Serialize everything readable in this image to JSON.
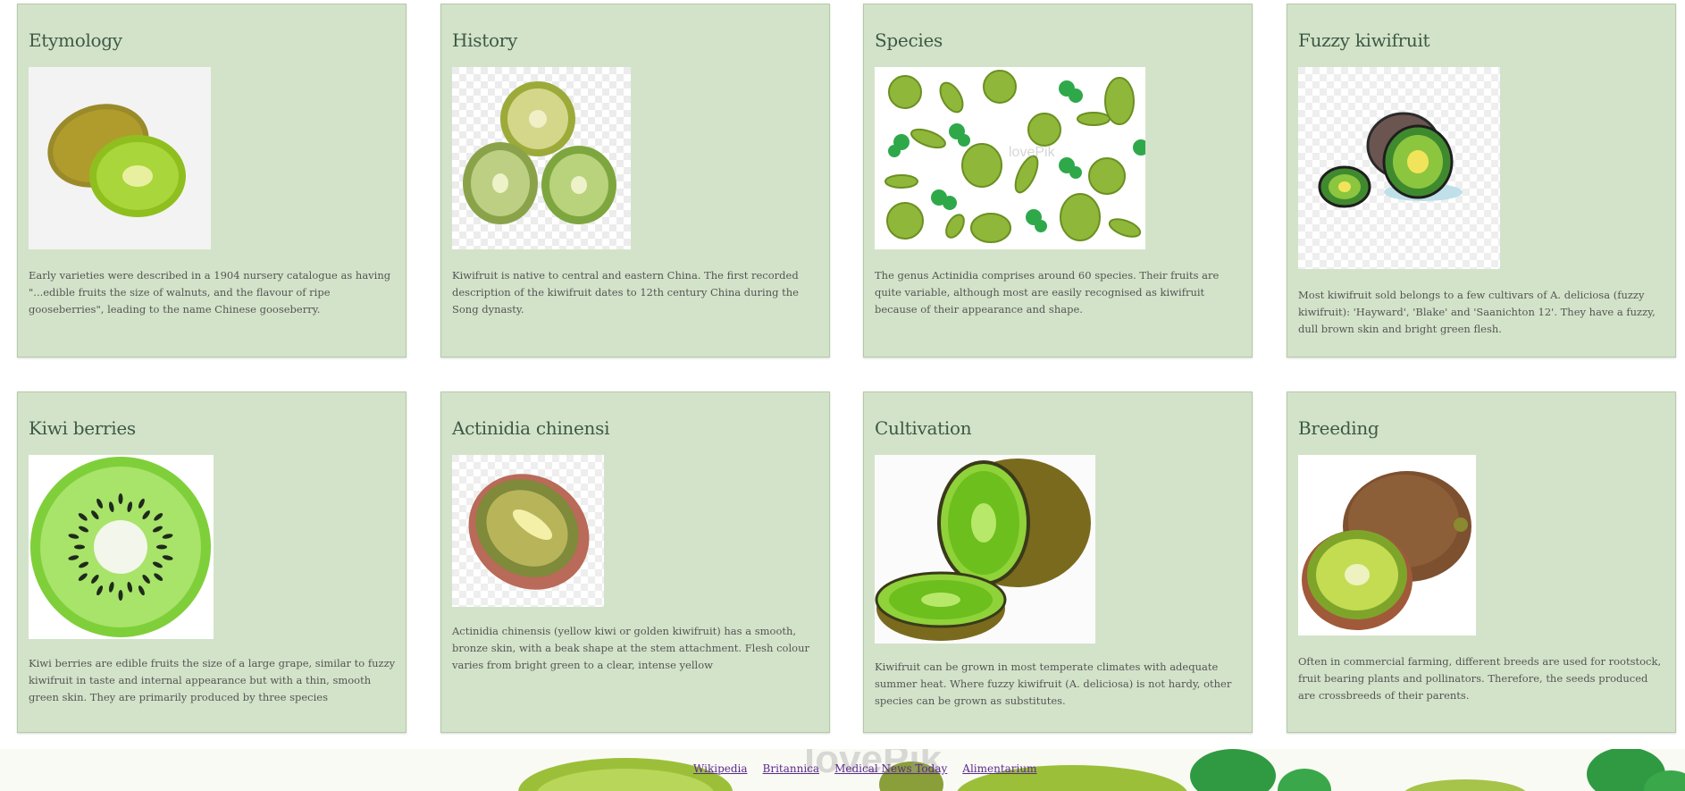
{
  "cards": [
    {
      "title": "Etymology",
      "image": "kiwi-whole-and-half",
      "text": "Early varieties were described in a 1904 nursery catalogue as having \"...edible fruits the size of walnuts, and the flavour of ripe gooseberries\", leading to the name Chinese gooseberry."
    },
    {
      "title": "History",
      "image": "kiwi-slices-three",
      "text": "Kiwifruit is native to central and eastern China. The first recorded description of the kiwifruit dates to 12th century China during the Song dynasty."
    },
    {
      "title": "Species",
      "image": "kiwi-slices-and-leaves-pattern",
      "text": "The genus Actinidia comprises around 60 species. Their fruits are quite variable, although most are easily recognised as kiwifruit because of their appearance and shape."
    },
    {
      "title": "Fuzzy kiwifruit",
      "image": "cartoon-kiwi-halves",
      "text": "Most kiwifruit sold belongs to a few cultivars of A. deliciosa (fuzzy kiwifruit): 'Hayward', 'Blake' and 'Saanichton 12'. They have a fuzzy, dull brown skin and bright green flesh."
    },
    {
      "title": "Kiwi berries",
      "image": "kiwi-cross-section",
      "text": "Kiwi berries are edible fruits the size of a large grape, similar to fuzzy kiwifruit in taste and internal appearance but with a thin, smooth green skin. They are primarily produced by three species"
    },
    {
      "title": "Actinidia chinensi",
      "image": "golden-kiwi-slice",
      "text": "Actinidia chinensis (yellow kiwi or golden kiwifruit) has a smooth, bronze skin, with a beak shape at the stem attachment. Flesh colour varies from bright green to a clear, intense yellow"
    },
    {
      "title": "Cultivation",
      "image": "cartoon-kiwi-cut",
      "text": "Kiwifruit can be grown in most temperate climates with adequate summer heat. Where fuzzy kiwifruit (A. deliciosa) is not hardy, other species can be grown as substitutes."
    },
    {
      "title": "Breeding",
      "image": "watercolor-kiwi-whole-and-half",
      "text": "Often in commercial farming, different breeds are used for rootstock, fruit bearing plants and pollinators. Therefore, the seeds produced are crossbreeds of their parents."
    }
  ],
  "footer": {
    "links": [
      "Wikipedia",
      "Britannica",
      "Medical News Today",
      "Alimentarium"
    ]
  },
  "colors": {
    "card_bg": "#d3e3c9",
    "title": "#3c5a45",
    "link": "#5a2a8c"
  }
}
